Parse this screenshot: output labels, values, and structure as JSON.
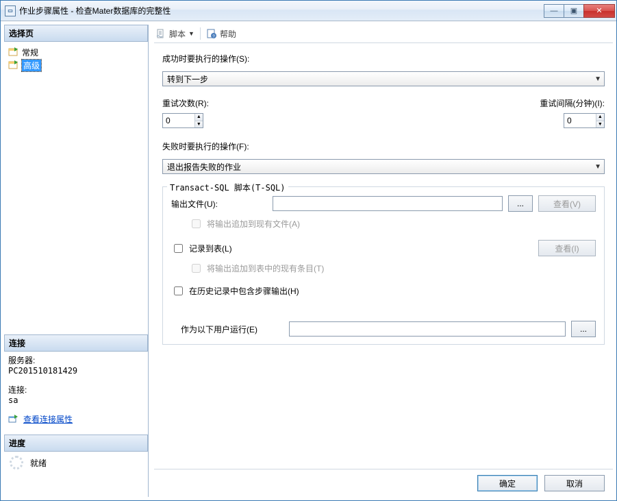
{
  "window": {
    "title": "作业步骤属性 - 检查Mater数据库的完整性",
    "buttons": {
      "min": "—",
      "max": "▣",
      "close": "✕"
    }
  },
  "sidebar": {
    "select_page_label": "选择页",
    "items": [
      {
        "label": "常规"
      },
      {
        "label": "高级"
      }
    ],
    "selected_index": 1
  },
  "connection": {
    "section_label": "连接",
    "server_label": "服务器:",
    "server_value": "PC201510181429",
    "conn_label": "连接:",
    "conn_value": "sa",
    "view_props_link": "查看连接属性"
  },
  "progress": {
    "section_label": "进度",
    "status": "就绪"
  },
  "toolbar": {
    "script_label": "脚本",
    "help_label": "帮助"
  },
  "form": {
    "on_success_label": "成功时要执行的操作(S):",
    "on_success_value": "转到下一步",
    "retry_count_label": "重试次数(R):",
    "retry_count_value": "0",
    "retry_interval_label": "重试间隔(分钟)(I):",
    "retry_interval_value": "0",
    "on_failure_label": "失败时要执行的操作(F):",
    "on_failure_value": "退出报告失败的作业",
    "tsql_legend": "Transact-SQL 脚本(T-SQL)",
    "output_file_label": "输出文件(U):",
    "output_file_value": "",
    "browse_btn": "...",
    "view_btn_v": "查看(V)",
    "append_file_label": "将输出追加到现有文件(A)",
    "log_table_label": "记录到表(L)",
    "view_btn_i": "查看(I)",
    "append_table_label": "将输出追加到表中的现有条目(T)",
    "include_history_label": "在历史记录中包含步骤输出(H)",
    "run_as_label": "作为以下用户运行(E)",
    "run_as_value": ""
  },
  "dialog": {
    "ok": "确定",
    "cancel": "取消"
  }
}
